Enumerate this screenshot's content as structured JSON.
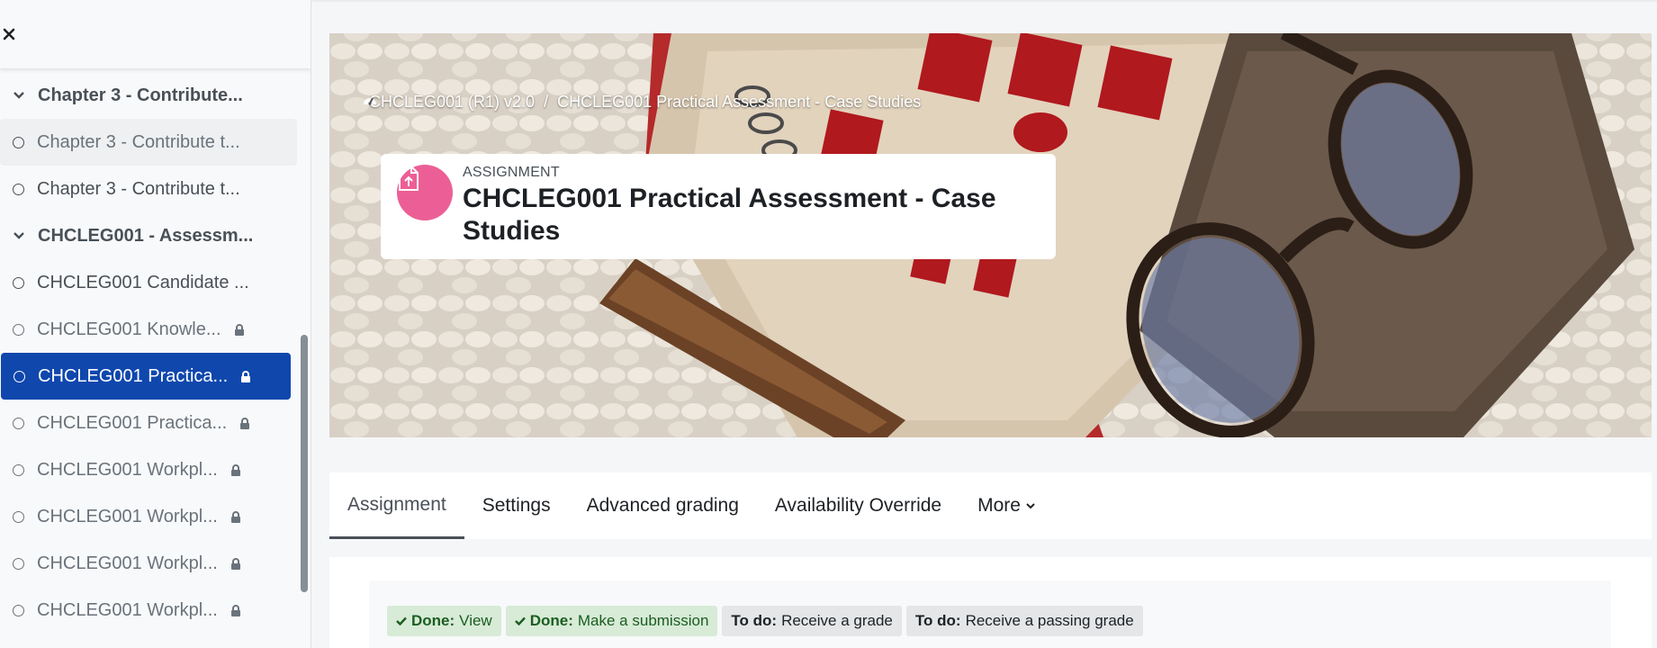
{
  "drawer": {
    "close_label": "×",
    "items": [
      {
        "kind": "section",
        "label": "Chapter 3 - Contribute..."
      },
      {
        "kind": "activity",
        "label": "Chapter 3 - Contribute t...",
        "locked": false,
        "state": "hover"
      },
      {
        "kind": "activity",
        "label": "Chapter 3 - Contribute t...",
        "locked": false,
        "state": ""
      },
      {
        "kind": "section",
        "label": "CHCLEG001 - Assessm..."
      },
      {
        "kind": "activity",
        "label": "CHCLEG001 Candidate ...",
        "locked": false,
        "state": ""
      },
      {
        "kind": "activity",
        "label": "CHCLEG001 Knowle...",
        "locked": true,
        "state": "dim"
      },
      {
        "kind": "activity",
        "label": "CHCLEG001 Practica...",
        "locked": true,
        "state": "active"
      },
      {
        "kind": "activity",
        "label": "CHCLEG001 Practica...",
        "locked": true,
        "state": "dim"
      },
      {
        "kind": "activity",
        "label": "CHCLEG001 Workpl...",
        "locked": true,
        "state": "dim"
      },
      {
        "kind": "activity",
        "label": "CHCLEG001 Workpl...",
        "locked": true,
        "state": "dim"
      },
      {
        "kind": "activity",
        "label": "CHCLEG001 Workpl...",
        "locked": true,
        "state": "dim"
      },
      {
        "kind": "activity",
        "label": "CHCLEG001 Workpl...",
        "locked": true,
        "state": "dim"
      }
    ]
  },
  "breadcrumb": {
    "course": "CHCLEG001 (R1) v2.0",
    "separator": "/",
    "current": "CHCLEG001 Practical Assessment - Case Studies"
  },
  "header": {
    "activity_type": "Assignment",
    "title": "CHCLEG001 Practical Assessment - Case Studies",
    "icon": "assignment-upload-icon",
    "icon_color": "#ec5f96"
  },
  "secondary_nav": {
    "tabs": [
      "Assignment",
      "Settings",
      "Advanced grading",
      "Availability Override"
    ],
    "more_label": "More",
    "active_index": 0
  },
  "completion": {
    "badges": [
      {
        "status": "Done:",
        "text": "View",
        "done": true
      },
      {
        "status": "Done:",
        "text": "Make a submission",
        "done": true
      },
      {
        "status": "To do:",
        "text": "Receive a grade",
        "done": false
      },
      {
        "status": "To do:",
        "text": "Receive a passing grade",
        "done": false
      }
    ]
  },
  "colors": {
    "active_item": "#0f47ad",
    "done_badge_bg": "#d7ebd7",
    "done_badge_text": "#1c5d20",
    "todo_badge_bg": "#e4e6e8"
  }
}
